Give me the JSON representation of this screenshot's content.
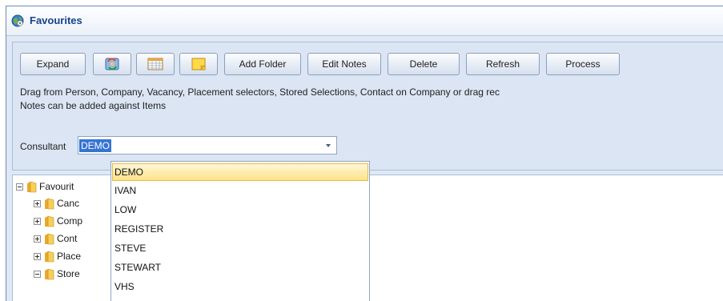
{
  "window": {
    "title": "Favourites",
    "icon": "globe-icon"
  },
  "toolbar": {
    "expand_label": "Expand",
    "icon_button_1": "refresh-people-icon",
    "icon_button_2": "grid-icon",
    "icon_button_3": "note-icon",
    "add_folder_label": "Add Folder",
    "edit_notes_label": "Edit Notes",
    "delete_label": "Delete",
    "refresh_label": "Refresh",
    "process_label": "Process"
  },
  "help": {
    "line1": "Drag from Person, Company, Vacancy, Placement selectors, Stored Selections, Contact on Company or drag rec",
    "line2": "Notes can be added against Items"
  },
  "consultant": {
    "label": "Consultant",
    "value": "DEMO",
    "options": [
      "DEMO",
      "IVAN",
      "LOW",
      "REGISTER",
      "STEVE",
      "STEWART",
      "VHS"
    ],
    "selected_index": 0
  },
  "tree": {
    "root": "Favourit",
    "children": [
      {
        "label": "Canc",
        "expanded": false
      },
      {
        "label": "Comp",
        "expanded": false
      },
      {
        "label": "Cont",
        "expanded": false
      },
      {
        "label": "Place",
        "expanded": false
      },
      {
        "label": "Store",
        "expanded": true
      }
    ]
  },
  "colors": {
    "accent": "#3574d4",
    "highlight": "#ffe38a",
    "title": "#15428b"
  }
}
